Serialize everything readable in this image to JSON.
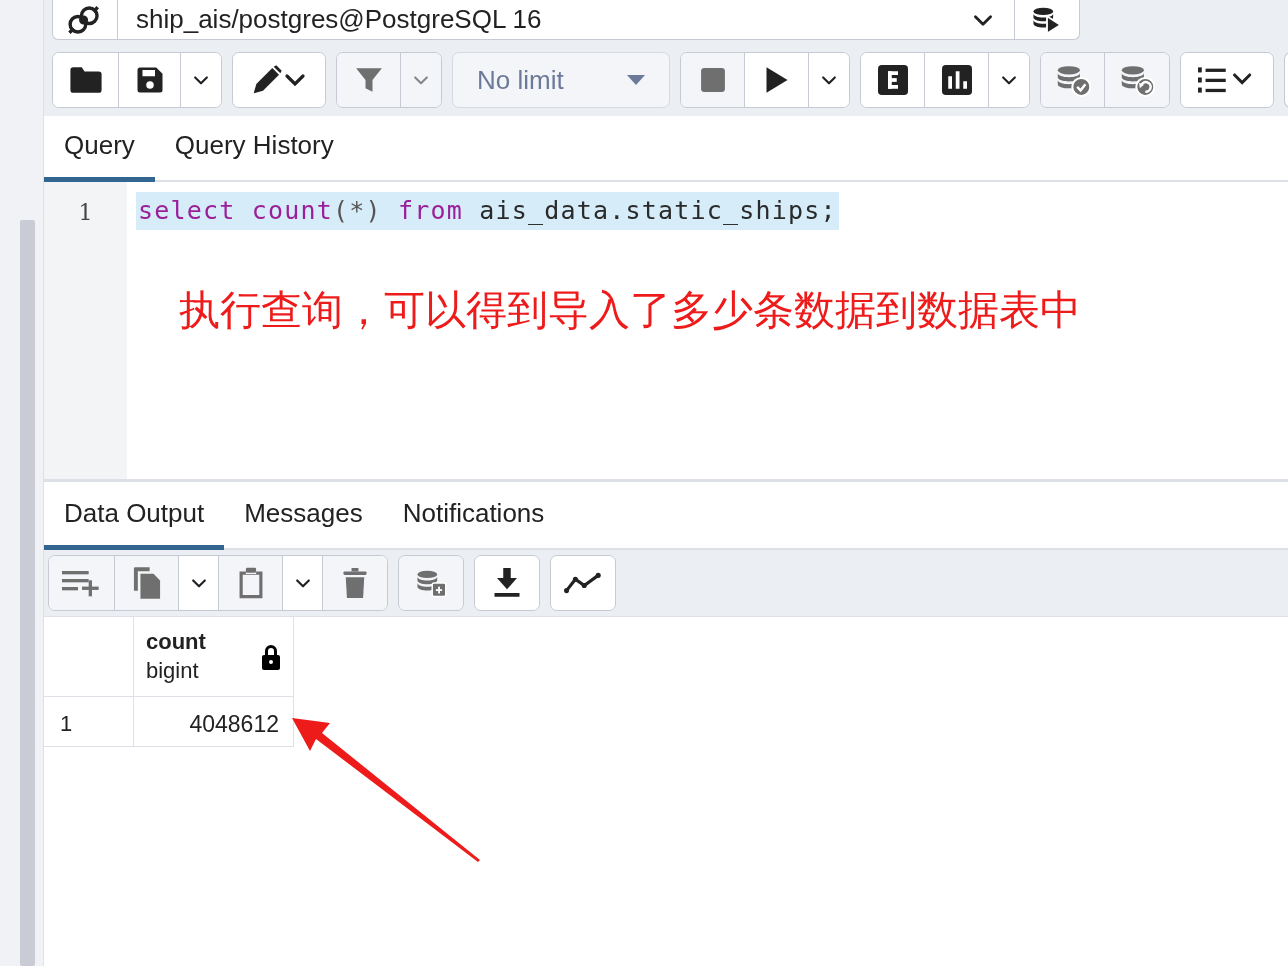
{
  "connection": {
    "title": "ship_ais/postgres@PostgreSQL 16"
  },
  "toolbar": {
    "groups": [
      {
        "buttons": [
          {
            "kind": "folder",
            "disabled": false
          },
          {
            "kind": "save",
            "disabled": false
          },
          {
            "kind": "caret",
            "disabled": false
          }
        ]
      },
      {
        "buttons": [
          {
            "kind": "pencil-caret",
            "disabled": false
          }
        ]
      },
      {
        "buttons": [
          {
            "kind": "filter",
            "disabled": true
          },
          {
            "kind": "caret",
            "disabled": true
          }
        ]
      },
      {
        "select": {
          "value": "No limit",
          "disabled": true
        }
      },
      {
        "buttons": [
          {
            "kind": "stop",
            "disabled": true
          },
          {
            "kind": "play",
            "disabled": false
          },
          {
            "kind": "caret",
            "disabled": false
          }
        ]
      },
      {
        "buttons": [
          {
            "kind": "explain",
            "disabled": false
          },
          {
            "kind": "chart",
            "disabled": false
          },
          {
            "kind": "caret",
            "disabled": false
          }
        ]
      },
      {
        "buttons": [
          {
            "kind": "db-check",
            "disabled": true
          },
          {
            "kind": "db-undo",
            "disabled": true
          }
        ]
      },
      {
        "buttons": [
          {
            "kind": "list-caret",
            "disabled": false
          }
        ]
      }
    ]
  },
  "editor_tabs": [
    {
      "label": "Query",
      "selected": true
    },
    {
      "label": "Query History",
      "selected": false
    }
  ],
  "editor": {
    "lines": [
      {
        "number": "1",
        "selected": true,
        "tokens": [
          {
            "text": "select",
            "kind": "keyword"
          },
          {
            "text": " count",
            "kind": "keyword"
          },
          {
            "text": "(*)",
            "kind": "punct"
          },
          {
            "text": " from",
            "kind": "keyword"
          },
          {
            "text": " ais_data.static_ships;",
            "kind": "plain"
          }
        ]
      }
    ]
  },
  "annotation": {
    "text": "执行查询，可以得到导入了多少条数据到数据表中"
  },
  "result_tabs": [
    {
      "label": "Data Output",
      "selected": true
    },
    {
      "label": "Messages",
      "selected": false
    },
    {
      "label": "Notifications",
      "selected": false
    }
  ],
  "result_toolbar": {
    "groups": [
      {
        "buttons": [
          {
            "kind": "add-row",
            "disabled": true
          },
          {
            "kind": "copy",
            "disabled": true
          },
          {
            "kind": "caret",
            "disabled": false
          },
          {
            "kind": "paste",
            "disabled": true
          },
          {
            "kind": "caret",
            "disabled": false
          },
          {
            "kind": "trash",
            "disabled": true
          }
        ]
      },
      {
        "buttons": [
          {
            "kind": "db-save",
            "disabled": true
          }
        ]
      },
      {
        "buttons": [
          {
            "kind": "download",
            "disabled": false
          }
        ]
      },
      {
        "buttons": [
          {
            "kind": "graph",
            "disabled": false
          }
        ]
      }
    ]
  },
  "grid": {
    "columns": [
      {
        "name": "count",
        "type": "bigint",
        "locked": true
      }
    ],
    "rows": [
      {
        "number": "1",
        "cells": [
          "4048612"
        ]
      }
    ]
  }
}
